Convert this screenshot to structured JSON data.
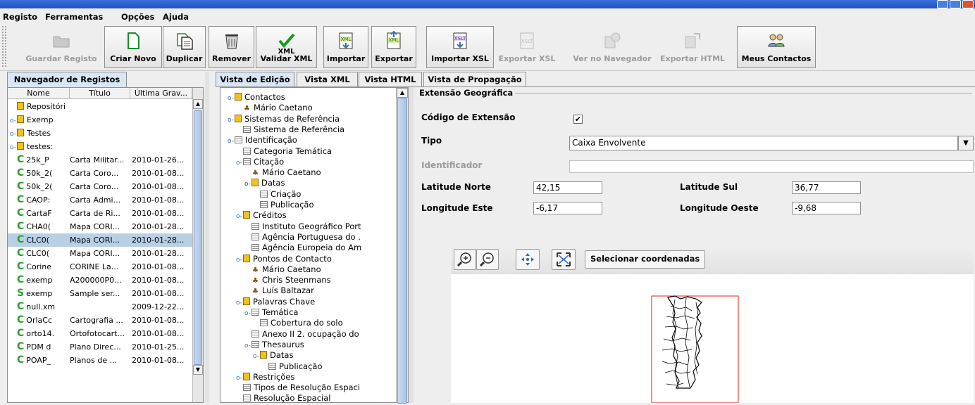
{
  "menu": [
    "Registo",
    "Ferramentas",
    "Opções",
    "Ajuda"
  ],
  "toolbar": [
    {
      "label": "Guardar Registo",
      "icon": "folder-open-icon",
      "enabled": false
    },
    {
      "label": "Criar Novo",
      "icon": "new-document-icon",
      "enabled": true
    },
    {
      "label": "Duplicar",
      "icon": "duplicate-icon",
      "enabled": true
    },
    {
      "label": "Remover",
      "icon": "trash-icon",
      "enabled": true
    },
    {
      "label": "Validar XML",
      "icon": "validate-xml-icon",
      "enabled": true
    },
    {
      "label": "Importar",
      "icon": "import-xml-icon",
      "enabled": true
    },
    {
      "label": "Exportar",
      "icon": "export-xml-icon",
      "enabled": true
    },
    {
      "label": "Importar XSL",
      "icon": "import-xsl-icon",
      "enabled": true
    },
    {
      "label": "Exportar XSL",
      "icon": "export-xsl-icon",
      "enabled": false
    },
    {
      "label": "Ver no Navegador",
      "icon": "browser-icon",
      "enabled": false
    },
    {
      "label": "Exportar HTML",
      "icon": "export-html-icon",
      "enabled": false
    },
    {
      "label": "Meus Contactos",
      "icon": "contacts-icon",
      "enabled": true
    }
  ],
  "toolbar_icon_text": {
    "validar": "XML",
    "importar": "XML",
    "exportar": "XML",
    "importar_xsl": "XSLT",
    "exportar_xsl": "XSLT"
  },
  "left_tab": "Navegador de Registos",
  "table": {
    "headers": [
      "Nome",
      "Título",
      "Última Grav..."
    ],
    "rows": [
      {
        "type": "folder",
        "expand": "",
        "name": "Repositóri",
        "title": "",
        "date": ""
      },
      {
        "type": "folder",
        "expand": "o-",
        "name": "Exemp",
        "title": "",
        "date": ""
      },
      {
        "type": "folder",
        "expand": "o-",
        "name": "Testes",
        "title": "",
        "date": ""
      },
      {
        "type": "folder",
        "expand": "o-",
        "name": "testes:",
        "title": "",
        "date": ""
      },
      {
        "type": "C",
        "name": "25k_P",
        "title": "Carta Militar...",
        "date": "2010-01-26..."
      },
      {
        "type": "C",
        "name": "50k_2(",
        "title": "Carta Coro...",
        "date": "2010-01-08..."
      },
      {
        "type": "C",
        "name": "50k_2(",
        "title": "Carta Coro...",
        "date": "2010-01-08..."
      },
      {
        "type": "C",
        "name": "CAOP:",
        "title": "Carta Admi...",
        "date": "2010-01-08..."
      },
      {
        "type": "C",
        "name": "CartaF",
        "title": "Carta de Ri...",
        "date": "2010-01-08..."
      },
      {
        "type": "C",
        "name": "CHA0(",
        "title": "Mapa CORI...",
        "date": "2010-01-28..."
      },
      {
        "type": "C",
        "name": "CLC0(",
        "title": "Mapa CORI...",
        "date": "2010-01-28...",
        "selected": true
      },
      {
        "type": "C",
        "name": "CLC0(",
        "title": "Mapa CORI...",
        "date": "2010-01-28..."
      },
      {
        "type": "C",
        "name": "Corine",
        "title": "CORINE La...",
        "date": "2010-01-08..."
      },
      {
        "type": "C",
        "name": "exemp",
        "title": "A200000P0...",
        "date": "2010-01-08..."
      },
      {
        "type": "S",
        "name": "exemp",
        "title": "Sample ser...",
        "date": "2010-01-08..."
      },
      {
        "type": "C",
        "name": "null.xm",
        "title": "",
        "date": "2009-12-22..."
      },
      {
        "type": "C",
        "name": "OrlaCc",
        "title": "Cartografia ...",
        "date": "2010-01-08..."
      },
      {
        "type": "C",
        "name": "orto14.",
        "title": "Ortofotocart...",
        "date": "2010-01-08..."
      },
      {
        "type": "C",
        "name": "PDM d",
        "title": "Plano Direc...",
        "date": "2010-01-25..."
      },
      {
        "type": "C",
        "name": "POAP_",
        "title": "Planos de ...",
        "date": "2010-01-08..."
      }
    ]
  },
  "tabs": [
    "Vista de Edição",
    "Vista XML",
    "Vista HTML",
    "Vista de Propagação"
  ],
  "tree": [
    {
      "depth": 0,
      "kind": "folder",
      "expand": true,
      "label": "Contactos"
    },
    {
      "depth": 1,
      "kind": "person",
      "label": "Mário Caetano"
    },
    {
      "depth": 0,
      "kind": "folder",
      "expand": true,
      "label": "Sistemas de Referência"
    },
    {
      "depth": 1,
      "kind": "doc",
      "label": "Sistema de Referência"
    },
    {
      "depth": 0,
      "kind": "doc",
      "expand": true,
      "label": "Identificação"
    },
    {
      "depth": 1,
      "kind": "doc",
      "label": "Categoria Temática"
    },
    {
      "depth": 1,
      "kind": "doc",
      "expand": true,
      "label": "Citação"
    },
    {
      "depth": 2,
      "kind": "person",
      "label": "Mário Caetano"
    },
    {
      "depth": 2,
      "kind": "folder",
      "expand": true,
      "label": "Datas"
    },
    {
      "depth": 3,
      "kind": "doc",
      "label": "Criação"
    },
    {
      "depth": 3,
      "kind": "doc",
      "label": "Publicação"
    },
    {
      "depth": 1,
      "kind": "folder",
      "expand": true,
      "label": "Créditos"
    },
    {
      "depth": 2,
      "kind": "doc",
      "label": "Instituto Geográfico Port"
    },
    {
      "depth": 2,
      "kind": "doc",
      "label": "Agência Portuguesa do ."
    },
    {
      "depth": 2,
      "kind": "doc",
      "label": "Agência Europeia do Am"
    },
    {
      "depth": 1,
      "kind": "folder",
      "expand": true,
      "label": "Pontos de Contacto"
    },
    {
      "depth": 2,
      "kind": "person",
      "label": "Mário Caetano"
    },
    {
      "depth": 2,
      "kind": "person",
      "label": "Chris Steenmans"
    },
    {
      "depth": 2,
      "kind": "person",
      "label": "Luís Baltazar"
    },
    {
      "depth": 1,
      "kind": "folder",
      "expand": true,
      "label": "Palavras Chave"
    },
    {
      "depth": 2,
      "kind": "doc",
      "expand": true,
      "label": "Temática"
    },
    {
      "depth": 3,
      "kind": "doc",
      "label": "Cobertura do solo"
    },
    {
      "depth": 2,
      "kind": "doc",
      "label": "Anexo II 2. ocupação do"
    },
    {
      "depth": 2,
      "kind": "doc",
      "expand": true,
      "label": "Thesaurus"
    },
    {
      "depth": 3,
      "kind": "folder",
      "expand": true,
      "label": "Datas"
    },
    {
      "depth": 4,
      "kind": "doc",
      "label": "Publicação"
    },
    {
      "depth": 1,
      "kind": "folder",
      "expand": true,
      "label": "Restrições"
    },
    {
      "depth": 1,
      "kind": "doc",
      "label": "Tipos de Resolução Espaci"
    },
    {
      "depth": 1,
      "kind": "doc",
      "label": "Resolução Espacial"
    }
  ],
  "form": {
    "section": "Extensão Geográfica",
    "codigo_label": "Código de Extensão",
    "codigo_checked": true,
    "tipo_label": "Tipo",
    "tipo_value": "Caixa Envolvente",
    "identificador_label": "Identificador",
    "identificador_value": "",
    "lat_norte_label": "Latitude Norte",
    "lat_norte_value": "42,15",
    "lat_sul_label": "Latitude Sul",
    "lat_sul_value": "36,77",
    "lon_este_label": "Longitude Este",
    "lon_este_value": "-6,17",
    "lon_oeste_label": "Longitude Oeste",
    "lon_oeste_value": "-9,68"
  },
  "map": {
    "select_button": "Selecionar coordenadas",
    "tools": [
      "zoom-in-icon",
      "zoom-out-icon",
      "pan-icon",
      "zoom-extent-icon"
    ],
    "bbox_color": "#e02020"
  },
  "colors": {
    "selection": "#b8cfe5",
    "checkmark_green": "#1a9a1a",
    "record_c": "#2e9d2e",
    "record_s": "#2e9d2e",
    "folder": "#f4c21a"
  }
}
